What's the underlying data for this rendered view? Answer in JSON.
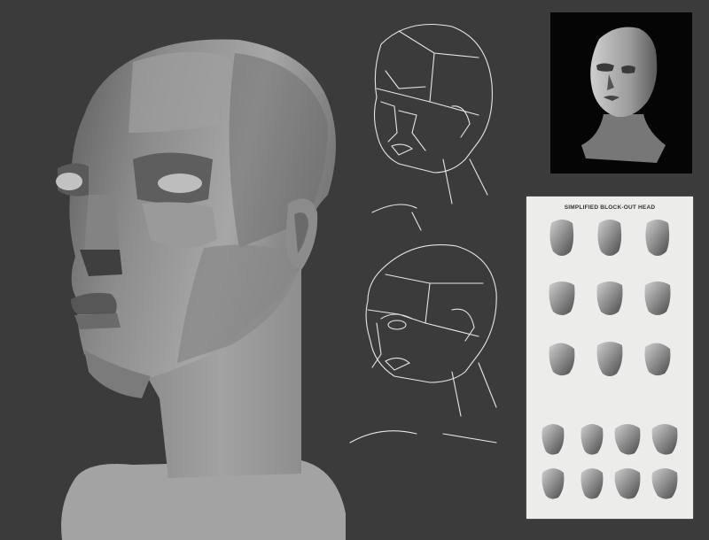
{
  "reference_sheet": {
    "title": "SIMPLIFIED BLOCK-OUT HEAD"
  },
  "colors": {
    "background": "#3b3b3b",
    "sketch_line": "#e6e6e6",
    "photo_background": "#050505",
    "sheet_background": "#ececeb"
  }
}
